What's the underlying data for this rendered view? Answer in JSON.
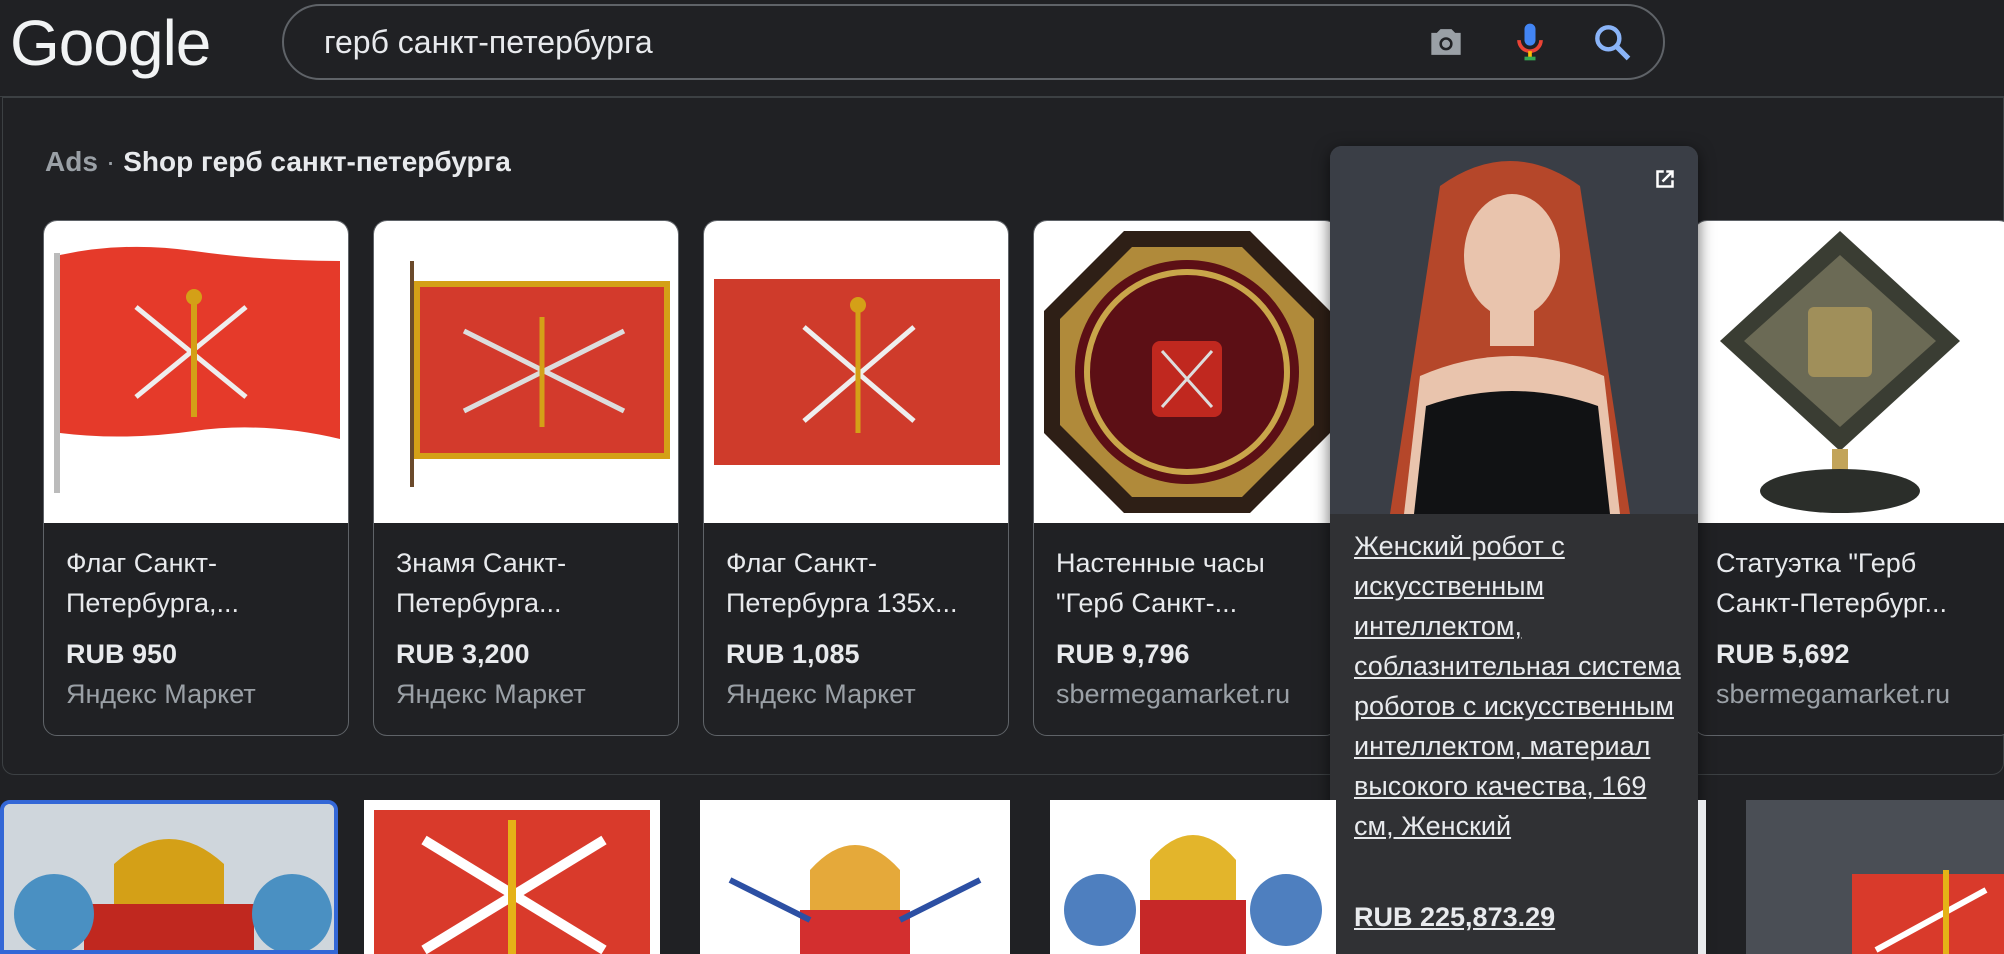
{
  "header": {
    "logo": "Google",
    "search_query": "герб санкт-петербурга"
  },
  "ads": {
    "label": "Ads",
    "dot": "·",
    "title": "Shop герб санкт-петербурга"
  },
  "products": [
    {
      "title": "Флаг Санкт-Петербурга,...",
      "price": "RUB 950",
      "seller": "Яндекс Маркет"
    },
    {
      "title": "Знамя Санкт-Петербурга...",
      "price": "RUB 3,200",
      "seller": "Яндекс Маркет"
    },
    {
      "title": "Флаг Санкт-Петербурга 135х...",
      "price": "RUB 1,085",
      "seller": "Яндекс Маркет"
    },
    {
      "title": "Настенные часы \"Герб Санкт-...",
      "price": "RUB 9,796",
      "seller": "sbermegamarket.ru"
    },
    {
      "title": "Статуэтка \"Герб Санкт-Петербург...",
      "price": "RUB 5,692",
      "seller": "sbermegamarket.ru"
    }
  ],
  "hover_product": {
    "title": "Женский робот с искусственным интеллектом, соблазнительная система роботов с искусственным интеллектом, материал высокого качества, 169 см, Женский",
    "price": "RUB 225,873.29"
  },
  "colors": {
    "background": "#202124",
    "flag_red": "#e53a2a",
    "google_blue": "#8ab4f8",
    "selected_border": "#3367d6"
  },
  "icons": [
    "camera-icon",
    "mic-icon",
    "search-icon",
    "open-in-new-icon"
  ]
}
